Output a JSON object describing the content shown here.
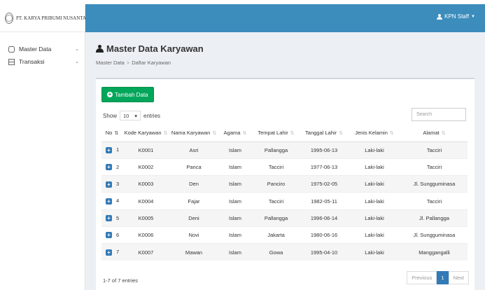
{
  "brand": {
    "name": "PT. KARYA PRIBUMI NUSANTARA"
  },
  "header": {
    "user": "KPN Staff"
  },
  "sidebar": {
    "items": [
      {
        "label": "Master Data",
        "icon": "database-icon"
      },
      {
        "label": "Transaksi",
        "icon": "table-icon"
      }
    ]
  },
  "page": {
    "title": "Master Data Karyawan",
    "breadcrumb": [
      "Master Data",
      "Daftar Karyawan"
    ]
  },
  "toolbar": {
    "add_label": "Tambah Data"
  },
  "length": {
    "show": "Show",
    "value": "10",
    "entries": "entries"
  },
  "search": {
    "placeholder": "Search"
  },
  "table": {
    "columns": [
      "No",
      "Kode Karyawan",
      "Nama Karyawan",
      "Agama",
      "Tempat Lahir",
      "Tanggal Lahir",
      "Jenis Kelamin",
      "Alamat"
    ],
    "rows": [
      [
        "1",
        "K0001",
        "Asri",
        "Islam",
        "Pallangga",
        "1995-06-13",
        "Laki-laki",
        "Tacciri"
      ],
      [
        "2",
        "K0002",
        "Panca",
        "Islam",
        "Tacciri",
        "1977-06-13",
        "Laki-laki",
        "Tacciri"
      ],
      [
        "3",
        "K0003",
        "Den",
        "Islam",
        "Panciro",
        "1975-02-05",
        "Laki-laki",
        "Jl. Sungguminasa"
      ],
      [
        "4",
        "K0004",
        "Fajar",
        "Islam",
        "Tacciri",
        "1982-05-11",
        "Laki-laki",
        "Tacciri"
      ],
      [
        "5",
        "K0005",
        "Deni",
        "Islam",
        "Pallangga",
        "1996-06-14",
        "Laki-laki",
        "Jl. Pallangga"
      ],
      [
        "6",
        "K0006",
        "Novi",
        "Islam",
        "Jakarta",
        "1980-06-16",
        "Laki-laki",
        "Jl. Sungguminasa"
      ],
      [
        "7",
        "K0007",
        "Mawan",
        "Islam",
        "Gowa",
        "1995-04-10",
        "Laki-laki",
        "Manggangalli"
      ]
    ]
  },
  "footer": {
    "info": "1-7 of 7 entries",
    "previous": "Previous",
    "page": "1",
    "next": "Next"
  },
  "colors": {
    "header": "#3c8dbc",
    "add_button": "#00a65a",
    "active_page": "#337ab7"
  }
}
